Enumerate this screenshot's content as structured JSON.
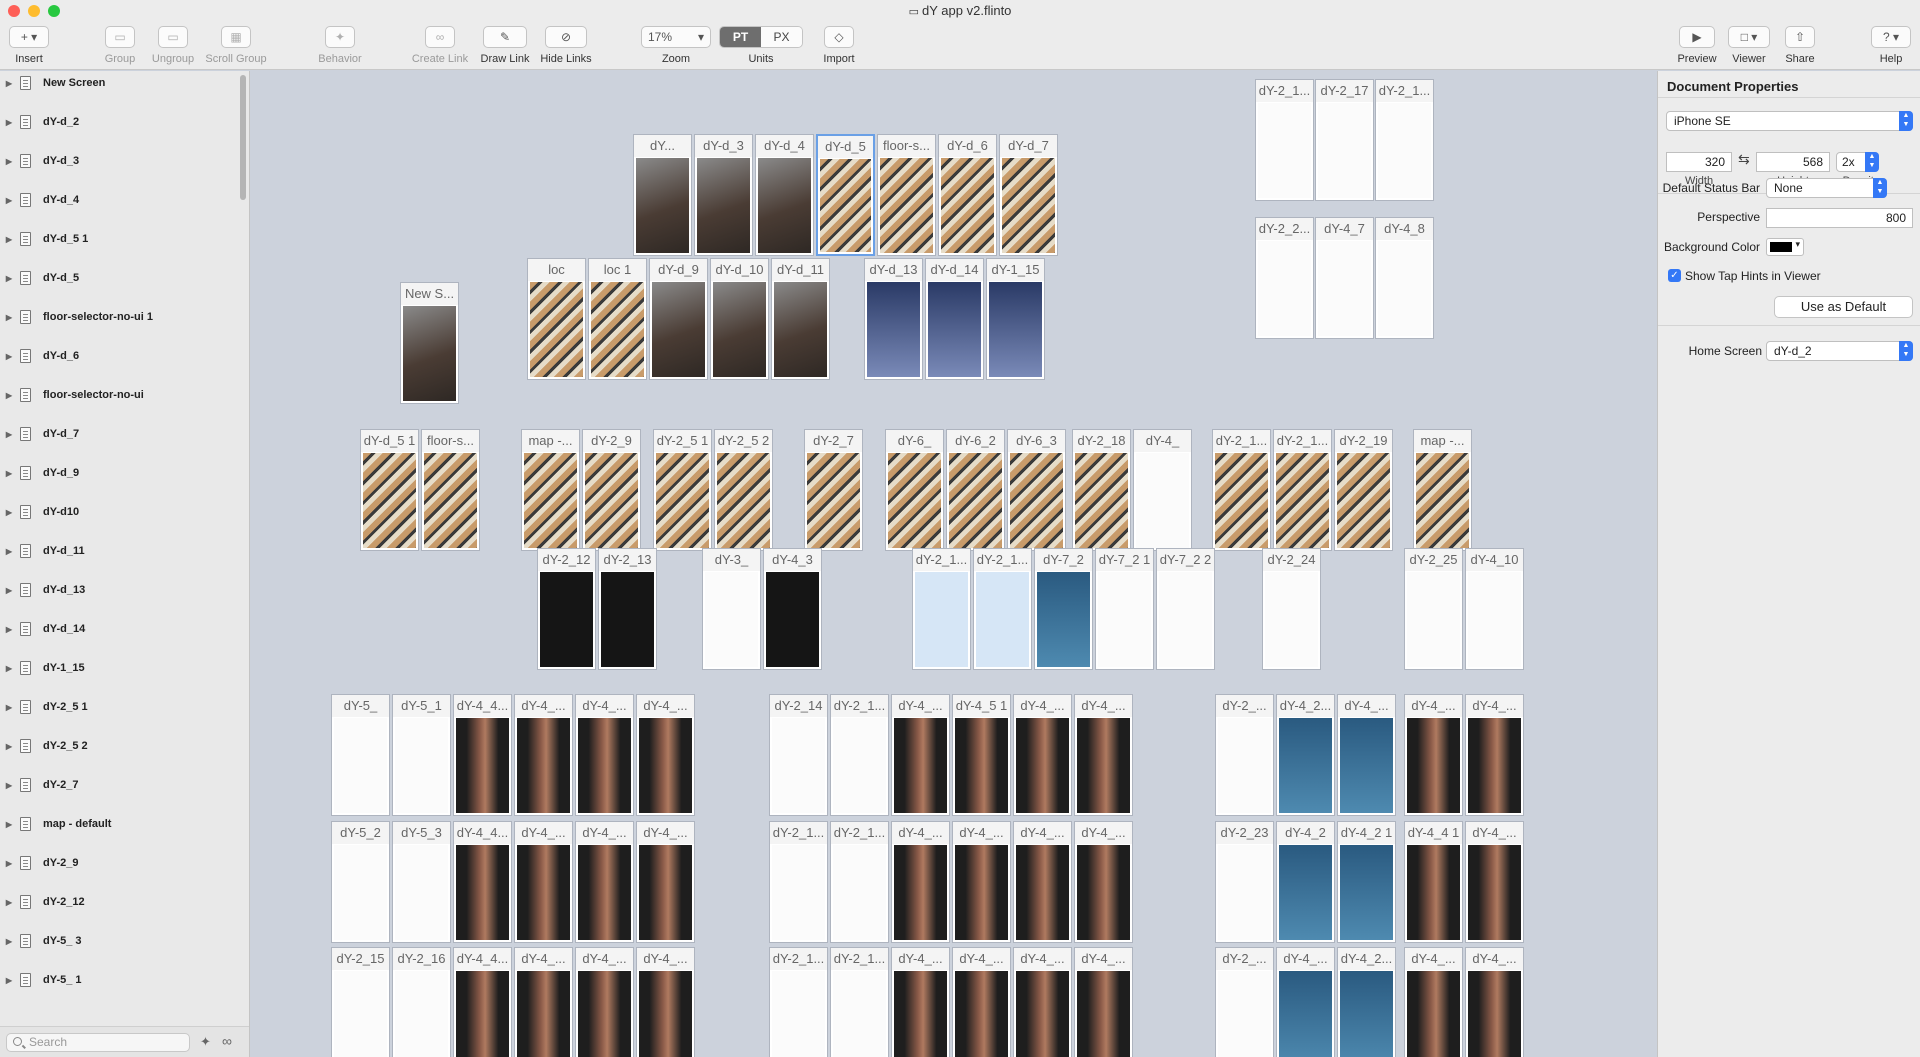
{
  "window": {
    "title": "dY app v2.flinto"
  },
  "toolbar": {
    "insert": "Insert",
    "group": "Group",
    "ungroup": "Ungroup",
    "scroll_group": "Scroll Group",
    "behavior": "Behavior",
    "create_link": "Create Link",
    "draw_link": "Draw Link",
    "hide_links": "Hide Links",
    "zoom_value": "17%",
    "zoom": "Zoom",
    "pt": "PT",
    "px": "PX",
    "units": "Units",
    "import": "Import",
    "preview": "Preview",
    "viewer": "Viewer",
    "share": "Share",
    "help": "Help"
  },
  "sidebar": {
    "items": [
      "New Screen",
      "dY-d_2",
      "dY-d_3",
      "dY-d_4",
      "dY-d_5 1",
      "dY-d_5",
      "floor-selector-no-ui 1",
      "dY-d_6",
      "floor-selector-no-ui",
      "dY-d_7",
      "dY-d_9",
      "dY-d10",
      "dY-d_11",
      "dY-d_13",
      "dY-d_14",
      "dY-1_15",
      "dY-2_5 1",
      "dY-2_5 2",
      "dY-2_7",
      "map - default",
      "dY-2_9",
      "dY-2_12",
      "dY-5_ 3",
      "dY-5_ 1"
    ],
    "search_placeholder": "Search"
  },
  "screens": [
    {
      "label": "New S...",
      "img": "photo"
    },
    {
      "label": "dY...",
      "img": "photo"
    },
    {
      "label": "dY-d_3",
      "img": "photo"
    },
    {
      "label": "dY-d_4",
      "img": "photo"
    },
    {
      "label": "dY-d_5",
      "img": "iso"
    },
    {
      "label": "floor-s...",
      "img": "iso"
    },
    {
      "label": "dY-d_6",
      "img": "iso"
    },
    {
      "label": "dY-d_7",
      "img": "iso"
    },
    {
      "label": "loc",
      "img": "iso"
    },
    {
      "label": "loc 1",
      "img": "iso"
    },
    {
      "label": "dY-d_9",
      "img": "photo"
    },
    {
      "label": "dY-d_10",
      "img": "photo"
    },
    {
      "label": "dY-d_11",
      "img": "photo"
    },
    {
      "label": "dY-d_13",
      "img": "lock"
    },
    {
      "label": "dY-d_14",
      "img": "lock"
    },
    {
      "label": "dY-1_15",
      "img": "lock"
    },
    {
      "label": "dY-2_1...",
      "img": "white"
    },
    {
      "label": "dY-2_17",
      "img": "white"
    },
    {
      "label": "dY-2_1...",
      "img": "white"
    },
    {
      "label": "dY-2_2...",
      "img": "white"
    },
    {
      "label": "dY-4_7",
      "img": "white"
    },
    {
      "label": "dY-4_8",
      "img": "white"
    },
    {
      "label": "dY-d_5 1",
      "img": "iso"
    },
    {
      "label": "floor-s...",
      "img": "iso"
    },
    {
      "label": "map -...",
      "img": "iso"
    },
    {
      "label": "dY-2_9",
      "img": "iso"
    },
    {
      "label": "dY-2_5 1",
      "img": "iso"
    },
    {
      "label": "dY-2_5 2",
      "img": "iso"
    },
    {
      "label": "dY-2_7",
      "img": "iso"
    },
    {
      "label": "dY-6_",
      "img": "iso"
    },
    {
      "label": "dY-6_2",
      "img": "iso"
    },
    {
      "label": "dY-6_3",
      "img": "iso"
    },
    {
      "label": "dY-2_18",
      "img": "iso"
    },
    {
      "label": "dY-4_",
      "img": "white"
    },
    {
      "label": "dY-2_1...",
      "img": "iso"
    },
    {
      "label": "dY-2_1...",
      "img": "iso"
    },
    {
      "label": "dY-2_19",
      "img": "iso"
    },
    {
      "label": "map -...",
      "img": "iso"
    },
    {
      "label": "dY-2_12",
      "img": "dark"
    },
    {
      "label": "dY-2_13",
      "img": "dark"
    },
    {
      "label": "dY-3_",
      "img": "white"
    },
    {
      "label": "dY-4_3",
      "img": "dark"
    },
    {
      "label": "dY-2_1...",
      "img": "blueui"
    },
    {
      "label": "dY-2_1...",
      "img": "blueui"
    },
    {
      "label": "dY-7_2",
      "img": "sat"
    },
    {
      "label": "dY-7_2 1",
      "img": "white"
    },
    {
      "label": "dY-7_2 2",
      "img": "white"
    },
    {
      "label": "dY-2_24",
      "img": "white"
    },
    {
      "label": "dY-2_25",
      "img": "white"
    },
    {
      "label": "dY-4_10",
      "img": "white"
    },
    {
      "label": "dY-5_",
      "img": "white"
    },
    {
      "label": "dY-5_1",
      "img": "white"
    },
    {
      "label": "dY-4_4...",
      "img": "vase"
    },
    {
      "label": "dY-4_...",
      "img": "vase"
    },
    {
      "label": "dY-4_...",
      "img": "vase"
    },
    {
      "label": "dY-4_...",
      "img": "vase"
    },
    {
      "label": "dY-2_14",
      "img": "white"
    },
    {
      "label": "dY-2_1...",
      "img": "white"
    },
    {
      "label": "dY-4_...",
      "img": "vase"
    },
    {
      "label": "dY-4_5 1",
      "img": "vase"
    },
    {
      "label": "dY-4_...",
      "img": "vase"
    },
    {
      "label": "dY-4_...",
      "img": "vase"
    },
    {
      "label": "dY-2_...",
      "img": "white"
    },
    {
      "label": "dY-4_2...",
      "img": "sat"
    },
    {
      "label": "dY-4_...",
      "img": "sat"
    },
    {
      "label": "dY-4_...",
      "img": "vase"
    },
    {
      "label": "dY-4_...",
      "img": "vase"
    },
    {
      "label": "dY-5_2",
      "img": "white"
    },
    {
      "label": "dY-5_3",
      "img": "white"
    },
    {
      "label": "dY-4_4...",
      "img": "vase"
    },
    {
      "label": "dY-4_...",
      "img": "vase"
    },
    {
      "label": "dY-4_...",
      "img": "vase"
    },
    {
      "label": "dY-4_...",
      "img": "vase"
    },
    {
      "label": "dY-2_1...",
      "img": "white"
    },
    {
      "label": "dY-2_1...",
      "img": "white"
    },
    {
      "label": "dY-4_...",
      "img": "vase"
    },
    {
      "label": "dY-4_...",
      "img": "vase"
    },
    {
      "label": "dY-4_...",
      "img": "vase"
    },
    {
      "label": "dY-4_...",
      "img": "vase"
    },
    {
      "label": "dY-2_23",
      "img": "white"
    },
    {
      "label": "dY-4_2",
      "img": "sat"
    },
    {
      "label": "dY-4_2 1",
      "img": "sat"
    },
    {
      "label": "dY-4_4 1",
      "img": "vase"
    },
    {
      "label": "dY-4_...",
      "img": "vase"
    },
    {
      "label": "dY-2_15",
      "img": "white"
    },
    {
      "label": "dY-2_16",
      "img": "white"
    },
    {
      "label": "dY-4_4...",
      "img": "vase"
    },
    {
      "label": "dY-4_...",
      "img": "vase"
    },
    {
      "label": "dY-4_...",
      "img": "vase"
    },
    {
      "label": "dY-4_...",
      "img": "vase"
    },
    {
      "label": "dY-2_1...",
      "img": "white"
    },
    {
      "label": "dY-2_1...",
      "img": "white"
    },
    {
      "label": "dY-4_...",
      "img": "vase"
    },
    {
      "label": "dY-4_...",
      "img": "vase"
    },
    {
      "label": "dY-4_...",
      "img": "vase"
    },
    {
      "label": "dY-4_...",
      "img": "vase"
    },
    {
      "label": "dY-2_...",
      "img": "white"
    },
    {
      "label": "dY-4_...",
      "img": "sat"
    },
    {
      "label": "dY-4_2...",
      "img": "sat"
    },
    {
      "label": "dY-4_...",
      "img": "vase"
    },
    {
      "label": "dY-4_...",
      "img": "vase"
    }
  ],
  "properties": {
    "title": "Document Properties",
    "device": "iPhone SE",
    "width_value": "320",
    "height_value": "568",
    "density_value": "2x",
    "width_label": "Width",
    "height_label": "Height",
    "density_label": "Density",
    "status_bar_label": "Default Status Bar",
    "status_bar_value": "None",
    "perspective_label": "Perspective",
    "perspective_value": "800",
    "bg_color_label": "Background Color",
    "bg_color": "#000000",
    "tap_hints_label": "Show Tap Hints in Viewer",
    "use_default": "Use as Default",
    "home_screen_label": "Home Screen",
    "home_screen_value": "dY-d_2"
  },
  "colors": {
    "accent": "#3478f6",
    "canvas": "#ccd2dc",
    "selection": "#6aa0e6"
  }
}
